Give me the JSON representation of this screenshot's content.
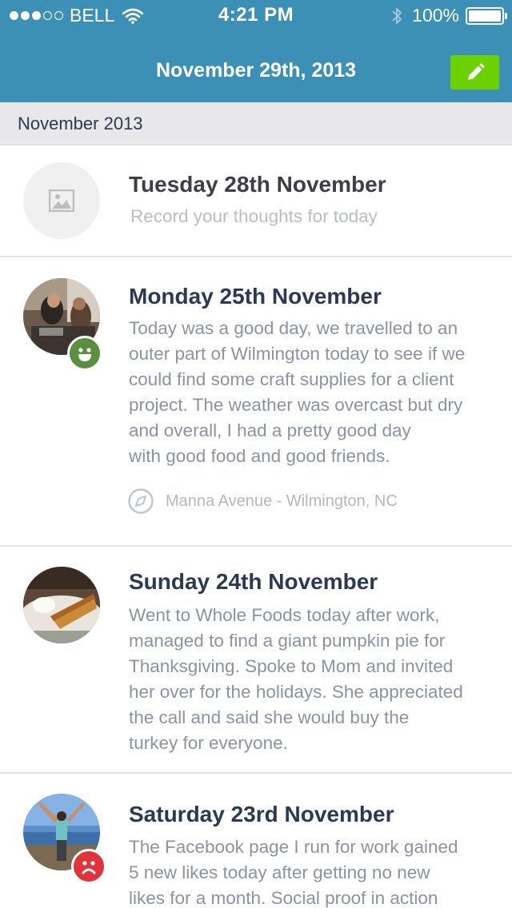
{
  "status_bar": {
    "carrier": "BELL",
    "time": "4:21 PM",
    "battery": "100%",
    "signal_bars_filled": 3,
    "signal_bars_total": 5
  },
  "nav": {
    "title": "November 29th, 2013",
    "edit_icon": "pencil-icon"
  },
  "section": {
    "label": "November 2013"
  },
  "entries": [
    {
      "title": "Tuesday 28th November",
      "prompt": "Record your thoughts for today",
      "image": "placeholder-image-icon"
    },
    {
      "title": "Monday 25th November",
      "text_lines": [
        "Today was a good day, we travelled to an",
        "outer part of Wilmington today to see if we",
        "could find some craft supplies for a client",
        "project. The weather was overcast but dry",
        "and overall, I had a pretty good day",
        "with good food and good friends."
      ],
      "location": "Manna Avenue - Wilmington, NC",
      "mood": "happy"
    },
    {
      "title": "Sunday 24th November",
      "text_lines": [
        "Went to Whole Foods today after work,",
        "managed to find a giant pumpkin pie for",
        "Thanksgiving. Spoke to Mom and invited",
        "her over for the holidays. She appreciated",
        "the call and said she would buy the",
        "turkey for everyone."
      ]
    },
    {
      "title": "Saturday 23rd November",
      "text_lines": [
        "The Facebook page I run for work gained",
        "5 new likes today after getting no new",
        "likes for a month. Social proof in action"
      ],
      "mood": "sad"
    }
  ],
  "colors": {
    "header": "#3c8fb5",
    "edit_button": "#6cd100",
    "happy_mood": "#5a8f3f",
    "sad_mood": "#e0333a",
    "title_text": "#2b3a52",
    "body_text": "#8a93a3"
  }
}
